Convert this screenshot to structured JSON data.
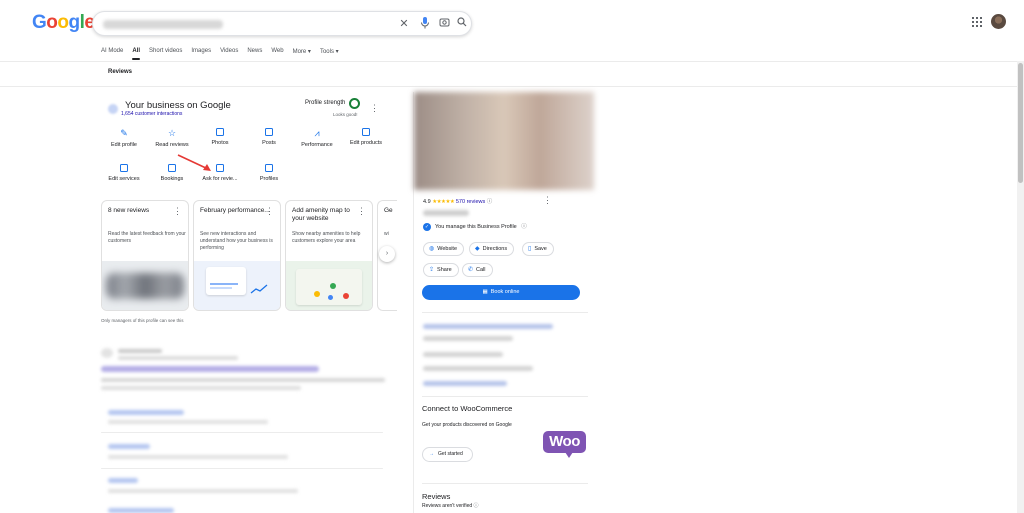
{
  "header": {
    "logo": [
      "G",
      "o",
      "o",
      "g",
      "l",
      "e"
    ],
    "logo_colors": [
      "#4285F4",
      "#EA4335",
      "#FBBC05",
      "#4285F4",
      "#34A853",
      "#EA4335"
    ],
    "search_icons": [
      "close-icon",
      "microphone-icon",
      "lens-icon",
      "search-icon"
    ]
  },
  "tabs": {
    "ai_mode": "AI Mode",
    "all": "All",
    "short_videos": "Short videos",
    "images": "Images",
    "videos": "Videos",
    "news": "News",
    "web": "Web",
    "more": "More ▾",
    "tools": "Tools ▾"
  },
  "subfilter": "Reviews",
  "business": {
    "title": "Your business on Google",
    "interactions": "1,654 customer interactions",
    "profile_strength": "Profile strength",
    "looks_good": "Looks good!",
    "actions_row1": {
      "edit_profile": "Edit profile",
      "read_reviews": "Read reviews",
      "photos": "Photos",
      "posts": "Posts",
      "performance": "Performance",
      "edit_products": "Edit products"
    },
    "actions_row2": {
      "edit_services": "Edit services",
      "bookings": "Bookings",
      "ask_for_reviews": "Ask for revie...",
      "profiles": "Profiles"
    }
  },
  "cards": {
    "c1": {
      "title": "8 new reviews",
      "desc": "Read the latest feedback from your customers"
    },
    "c2": {
      "title": "February performance...",
      "desc": "See new interactions and understand how your business is performing"
    },
    "c3": {
      "title": "Add amenity map to your website",
      "desc": "Show nearby amenities to help customers explore your area"
    },
    "c4": {
      "title": "Ge",
      "desc": "wi"
    }
  },
  "only_managers": "Only managers of this profile can see this",
  "right": {
    "rating_value": "4.9",
    "stars": "★★★★★",
    "reviews_link": "570 reviews",
    "manage_text": "You manage this Business Profile",
    "chips": {
      "website": "Website",
      "directions": "Directions",
      "save": "Save",
      "share": "Share",
      "call": "Call"
    },
    "book_online": "Book online",
    "woo_title": "Connect to WooCommerce",
    "woo_sub": "Get your products discovered on Google",
    "woo_logo": "Woo",
    "get_started": "Get started",
    "reviews_heading": "Reviews",
    "reviews_sub": "Reviews aren't verified"
  },
  "colors": {
    "accent": "#1a73e8",
    "link": "#1a0dab",
    "arrow": "#e53935",
    "woo_purple": "#7f54b3",
    "strength_ring": "#188038",
    "star": "#fbbc04"
  }
}
